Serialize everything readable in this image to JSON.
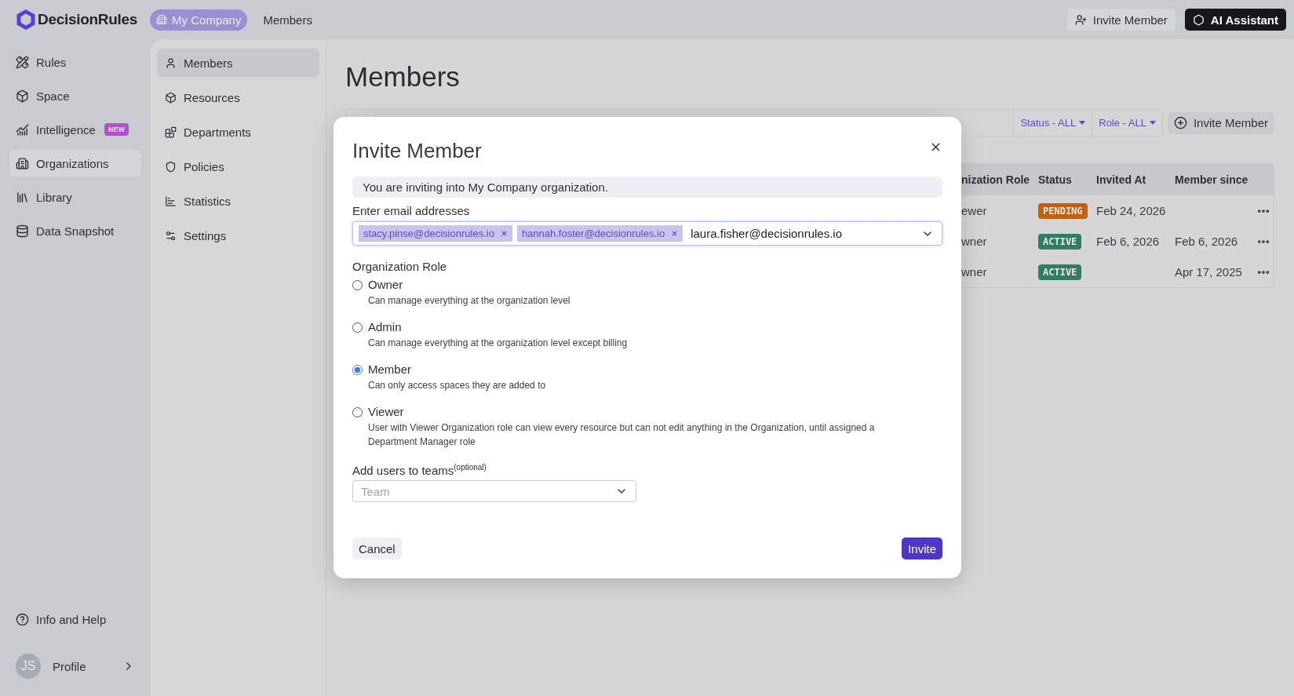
{
  "topbar": {
    "logo": "DecisionRules",
    "breadcrumbs": [
      {
        "label": "My Company",
        "selected": true
      },
      {
        "label": "Members",
        "selected": false
      }
    ],
    "actions": [
      {
        "label": "Invite Member",
        "kind": "light"
      },
      {
        "label": "AI Assistant",
        "kind": "dark"
      }
    ]
  },
  "sidebar": {
    "items": [
      {
        "label": "Rules",
        "selected": false
      },
      {
        "label": "Space",
        "selected": false
      },
      {
        "label": "Intelligence",
        "badge": "NEW",
        "selected": false
      },
      {
        "label": "Organizations",
        "selected": true
      },
      {
        "label": "Library",
        "selected": false
      },
      {
        "label": "Data Snapshot",
        "selected": false
      }
    ],
    "help": "Info and Help",
    "profile": {
      "initials": "JS",
      "label": "Profile"
    }
  },
  "subnav": {
    "items": [
      {
        "label": "Members",
        "selected": true
      },
      {
        "label": "Resources",
        "selected": false
      },
      {
        "label": "Departments",
        "selected": false
      },
      {
        "label": "Policies",
        "selected": false
      },
      {
        "label": "Statistics",
        "selected": false
      },
      {
        "label": "Settings",
        "selected": false
      }
    ]
  },
  "page": {
    "title": "Members",
    "filters": [
      "Status - ALL",
      "Role - ALL"
    ],
    "invite_button": "Invite Member",
    "table": {
      "columns": [
        "nization Role",
        "Status",
        "Invited At",
        "Member since"
      ],
      "rows": [
        {
          "role": "ewer",
          "status": "PENDING",
          "color": "#c45f10",
          "invited_at": "Feb 24, 2026"
        },
        {
          "role": "wner",
          "status": "ACTIVE",
          "color": "#2f7d68",
          "invited_at": "Feb 6, 2026",
          "member_since": "Feb 6, 2026"
        },
        {
          "role": "wner",
          "status": "ACTIVE",
          "color": "#2f7d68",
          "member_since": "Apr 17, 2025"
        }
      ]
    }
  },
  "modal": {
    "title": "Invite Member",
    "notice": "You are inviting into My Company organization.",
    "email_label": "Enter email addresses",
    "emails": [
      "stacy.pinse@decisionrules.io",
      "hannah.foster@decisionrules.io"
    ],
    "email_input": "laura.fisher@decisionrules.io",
    "role_label": "Organization Role",
    "roles": [
      {
        "label": "Owner",
        "description": "Can manage everything at the organization level",
        "selected": false
      },
      {
        "label": "Admin",
        "description": "Can manage everything at the organization level except billing",
        "selected": false
      },
      {
        "label": "Member",
        "description": "Can only access spaces they are added to",
        "selected": true
      },
      {
        "label": "Viewer",
        "description": "User with Viewer Organization role can view every resource but can not edit anything in the Organization, until assigned a Department Manager role",
        "selected": false
      }
    ],
    "teams_label": "Add users to teams$^{(optional)}$",
    "teams_placeholder": "Team",
    "cancel": "Cancel",
    "submit": "Invite"
  }
}
